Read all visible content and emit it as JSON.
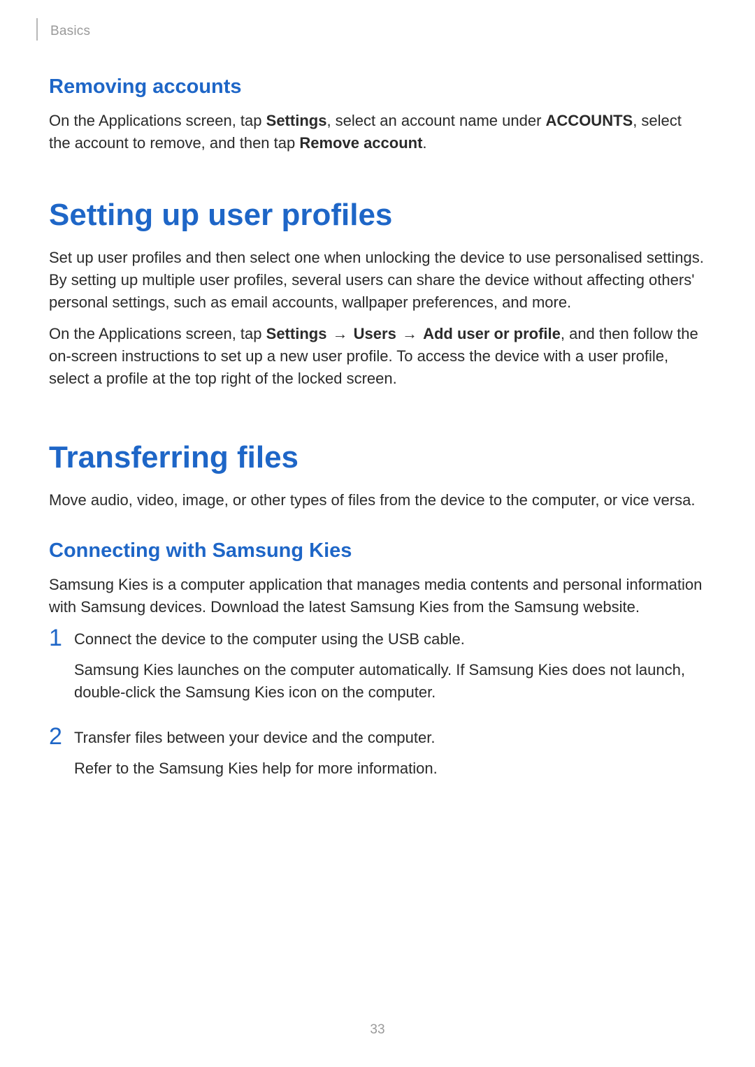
{
  "header": {
    "section": "Basics"
  },
  "removing_accounts": {
    "heading": "Removing accounts",
    "para_parts": [
      {
        "t": "On the Applications screen, tap "
      },
      {
        "t": "Settings",
        "b": true
      },
      {
        "t": ", select an account name under "
      },
      {
        "t": "ACCOUNTS",
        "b": true
      },
      {
        "t": ", select the account to remove, and then tap "
      },
      {
        "t": "Remove account",
        "b": true
      },
      {
        "t": "."
      }
    ]
  },
  "user_profiles": {
    "heading": "Setting up user profiles",
    "para1": "Set up user profiles and then select one when unlocking the device to use personalised settings. By setting up multiple user profiles, several users can share the device without affecting others' personal settings, such as email accounts, wallpaper preferences, and more.",
    "para2_parts": [
      {
        "t": "On the Applications screen, tap "
      },
      {
        "t": "Settings",
        "b": true
      },
      {
        "t": " → ",
        "arrow": true
      },
      {
        "t": "Users",
        "b": true
      },
      {
        "t": " → ",
        "arrow": true
      },
      {
        "t": "Add user or profile",
        "b": true
      },
      {
        "t": ", and then follow the on-screen instructions to set up a new user profile. To access the device with a user profile, select a profile at the top right of the locked screen."
      }
    ]
  },
  "transferring_files": {
    "heading": "Transferring files",
    "para": "Move audio, video, image, or other types of files from the device to the computer, or vice versa."
  },
  "kies": {
    "heading": "Connecting with Samsung Kies",
    "para": "Samsung Kies is a computer application that manages media contents and personal information with Samsung devices. Download the latest Samsung Kies from the Samsung website.",
    "steps": [
      {
        "num": "1",
        "lines": [
          "Connect the device to the computer using the USB cable.",
          "Samsung Kies launches on the computer automatically. If Samsung Kies does not launch, double-click the Samsung Kies icon on the computer."
        ]
      },
      {
        "num": "2",
        "lines": [
          "Transfer files between your device and the computer.",
          "Refer to the Samsung Kies help for more information."
        ]
      }
    ]
  },
  "page_number": "33"
}
